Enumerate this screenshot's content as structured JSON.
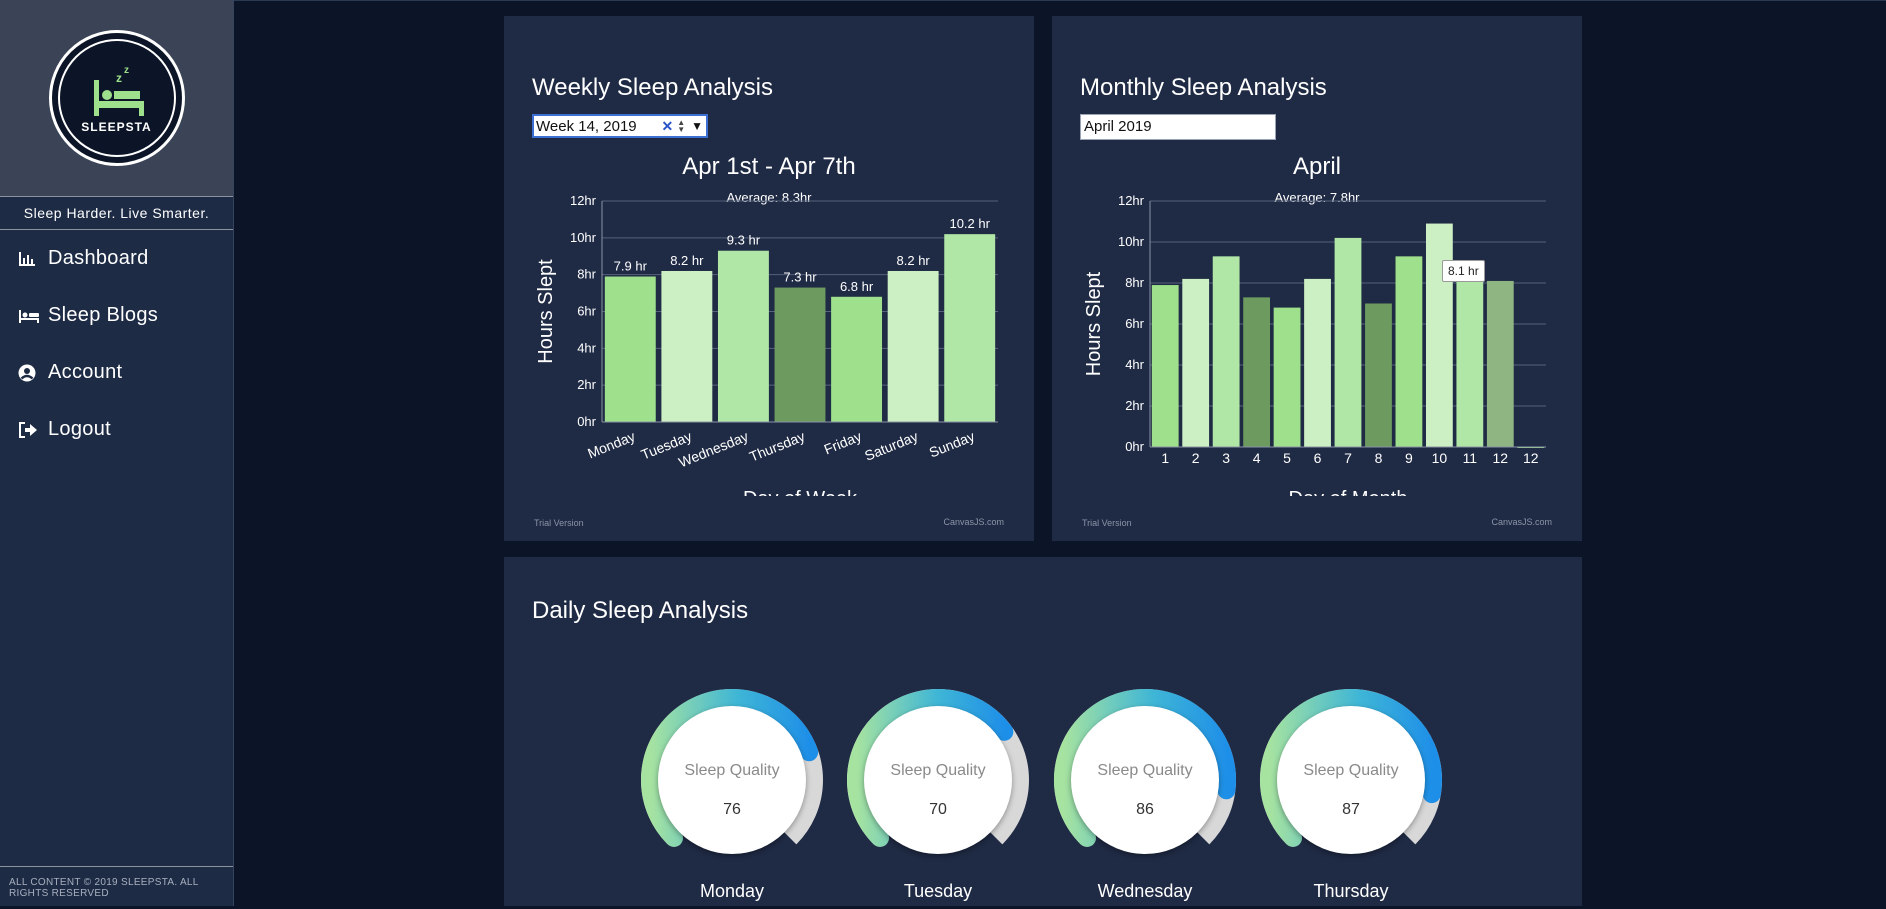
{
  "sidebar": {
    "logo_text": "SLEEPSTA",
    "tagline": "Sleep Harder. Live Smarter.",
    "items": [
      {
        "label": "Dashboard",
        "icon": "bar-chart-icon"
      },
      {
        "label": "Sleep Blogs",
        "icon": "bed-icon"
      },
      {
        "label": "Account",
        "icon": "user-circle-icon"
      },
      {
        "label": "Logout",
        "icon": "logout-icon"
      }
    ],
    "footer_line1": "ALL CONTENT © 2019 SLEEPSTA. ALL",
    "footer_line2": "RIGHTS RESERVED"
  },
  "weekly": {
    "panel_title": "Weekly Sleep Analysis",
    "week_input_value": "Week 14, 2019",
    "trial_text": "Trial Version",
    "credit_text": "CanvasJS.com"
  },
  "monthly": {
    "panel_title": "Monthly Sleep Analysis",
    "month_input_value": "April 2019",
    "trial_text": "Trial Version",
    "credit_text": "CanvasJS.com",
    "tooltip": "8.1 hr"
  },
  "daily": {
    "panel_title": "Daily Sleep Analysis",
    "gauges": [
      {
        "label": "Sleep Quality",
        "value": 76,
        "day": "Monday"
      },
      {
        "label": "Sleep Quality",
        "value": 70,
        "day": "Tuesday"
      },
      {
        "label": "Sleep Quality",
        "value": 86,
        "day": "Wednesday"
      },
      {
        "label": "Sleep Quality",
        "value": 87,
        "day": "Thursday"
      }
    ]
  },
  "colors": {
    "green_light": "#9ee08c",
    "green_pale": "#cdefc4",
    "green_mid": "#b1e7a6",
    "green_dark": "#6c9a5f",
    "gauge_blue": "#1e90e8",
    "gauge_track": "#d8d8d8"
  },
  "chart_data": [
    {
      "type": "bar",
      "title": "Apr 1st - Apr 7th",
      "subtitle": "Average: 8.3hr",
      "xlabel": "Day of Week",
      "ylabel": "Hours Slept",
      "ylim": [
        0,
        12
      ],
      "yticks": [
        "0hr",
        "2hr",
        "4hr",
        "6hr",
        "8hr",
        "10hr",
        "12hr"
      ],
      "categories": [
        "Monday",
        "Tuesday",
        "Wednesday",
        "Thursday",
        "Friday",
        "Saturday",
        "Sunday"
      ],
      "values": [
        7.9,
        8.2,
        9.3,
        7.3,
        6.8,
        8.2,
        10.2
      ],
      "labels": [
        "7.9 hr",
        "8.2 hr",
        "9.3 hr",
        "7.3 hr",
        "6.8 hr",
        "8.2 hr",
        "10.2 hr"
      ],
      "colors": [
        "#9ee08c",
        "#cdefc4",
        "#b1e7a6",
        "#6c9a5f",
        "#9ee08c",
        "#cdefc4",
        "#b1e7a6"
      ],
      "grid": true
    },
    {
      "type": "bar",
      "title": "April",
      "subtitle": "Average: 7.8hr",
      "xlabel": "Day of Month",
      "ylabel": "Hours Slept",
      "ylim": [
        0,
        12
      ],
      "yticks": [
        "0hr",
        "2hr",
        "4hr",
        "6hr",
        "8hr",
        "10hr",
        "12hr"
      ],
      "categories": [
        "1",
        "2",
        "3",
        "4",
        "5",
        "6",
        "7",
        "8",
        "9",
        "10",
        "11",
        "12",
        "12"
      ],
      "values": [
        7.9,
        8.2,
        9.3,
        7.3,
        6.8,
        8.2,
        10.2,
        7.0,
        9.3,
        10.9,
        8.1,
        8.1,
        0
      ],
      "colors": [
        "#9ee08c",
        "#cdefc4",
        "#b1e7a6",
        "#6c9a5f",
        "#9ee08c",
        "#cdefc4",
        "#b1e7a6",
        "#6c9a5f",
        "#9ee08c",
        "#cdefc4",
        "#b1e7a6",
        "#8fb583",
        "#9ee08c"
      ],
      "grid": true
    }
  ]
}
